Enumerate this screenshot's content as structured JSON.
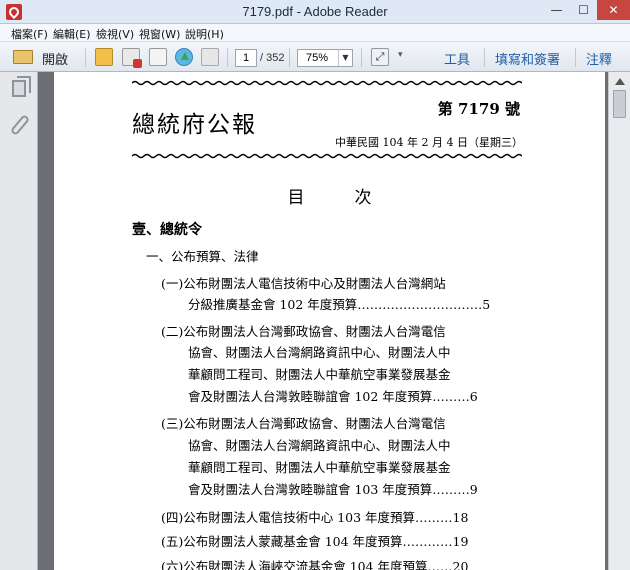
{
  "window": {
    "title": "7179.pdf - Adobe Reader",
    "minimize": "—",
    "maximize": "☐",
    "close": "✕"
  },
  "menu": [
    "檔案(F)",
    "編輯(E)",
    "檢視(V)",
    "視窗(W)",
    "說明(H)"
  ],
  "toolbar": {
    "open_label": "開啟",
    "current_page": "1",
    "total_pages": "/ 352",
    "zoom": "75%",
    "tools_label": "工具",
    "fill_sign_label": "填寫和簽署",
    "comment_label": "注釋",
    "link_color": "#1f5fa8"
  },
  "icons": {
    "open": "folder-open-icon",
    "email": "email-gear-icon",
    "create_pdf": "create-pdf-icon",
    "edit": "edit-document-icon",
    "share": "cloud-upload-icon",
    "save": "save-disk-icon",
    "fit": "fit-width-icon",
    "pages_panel": "pages-icon",
    "attachments": "paperclip-icon"
  },
  "document": {
    "title": "總統府公報",
    "issue": "第 7179 號",
    "date": "中華民國 104 年 2 月 4 日（星期三）",
    "toc_heading": "目次",
    "section": "壹、總統令",
    "subsection": "一、公布預算、法律",
    "lines": [
      "(一)公布財團法人電信技術中心及財團法人台灣網站",
      "分級推廣基金會 102 年度預算…………………………5",
      "(二)公布財團法人台灣郵政協會、財團法人台灣電信",
      "協會、財團法人台灣網路資訊中心、財團法人中",
      "華顧問工程司、財團法人中華航空事業發展基金",
      "會及財團法人台灣敦睦聯誼會 102 年度預算………6",
      "(三)公布財團法人台灣郵政協會、財團法人台灣電信",
      "協會、財團法人台灣網路資訊中心、財團法人中",
      "華顧問工程司、財團法人中華航空事業發展基金",
      "會及財團法人台灣敦睦聯誼會 103 年度預算………9",
      "(四)公布財團法人電信技術中心  103  年度預算………18",
      "(五)公布財團法人蒙藏基金會  104  年度預算…………19",
      "(六)公布財團法人海峽交流基金會  104  年度預算……20"
    ]
  }
}
